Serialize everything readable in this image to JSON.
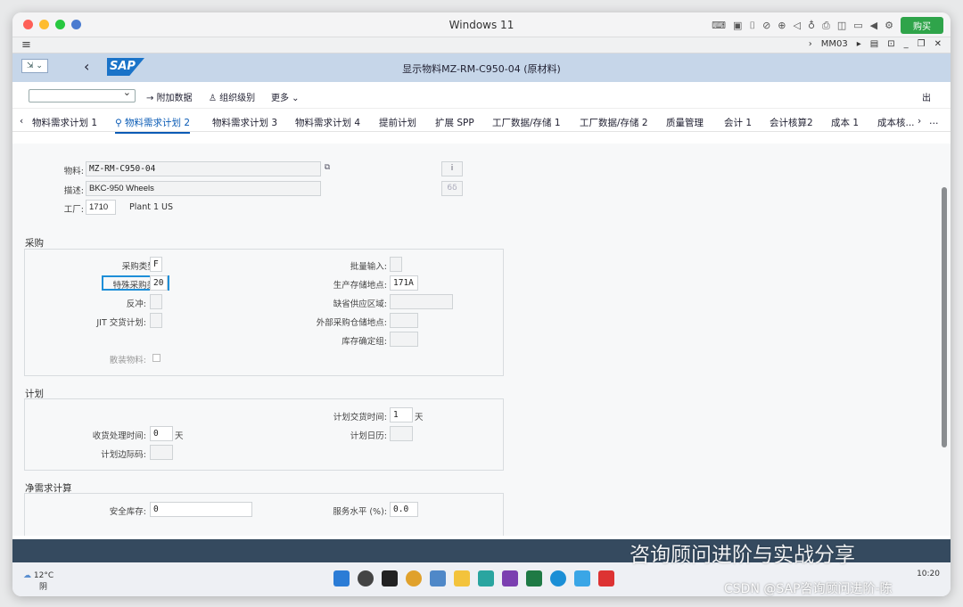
{
  "window": {
    "title": "Windows 11",
    "buy_label": "购买"
  },
  "menubar": {
    "right": [
      "MM03"
    ]
  },
  "shell": {
    "menu_label": "⇲ ⌄",
    "page_title": "显示物料MZ-RM-C950-04 (原材料)"
  },
  "toolbar": {
    "additional_data": "附加数据",
    "org_levels": "组织级别",
    "more": "更多",
    "exit": "出"
  },
  "tabs": [
    "物料需求计划 1",
    "物料需求计划 2",
    "物料需求计划 3",
    "物料需求计划 4",
    "提前计划",
    "扩展 SPP",
    "工厂数据/存储 1",
    "工厂数据/存储 2",
    "质量管理",
    "会计 1",
    "会计核算2",
    "成本 1",
    "成本核..."
  ],
  "active_tab": "物料需求计划 2",
  "header": {
    "material_label": "物料:",
    "material_value": "MZ-RM-C950-04",
    "desc_label": "描述:",
    "desc_value": "BKC-950 Wheels",
    "plant_label": "工厂:",
    "plant_value": "1710",
    "plant_name": "Plant 1 US",
    "info_icon": "i",
    "link_icon": "6δ"
  },
  "purchasing": {
    "title": "采购",
    "proc_type_label": "采购类型:",
    "proc_type_value": "F",
    "special_proc_label": "特殊采购类:",
    "special_proc_value": "20",
    "backflush_label": "反冲:",
    "jit_label": "JIT 交货计划:",
    "bulk_label": "散装物料:",
    "batch_entry_label": "批量输入:",
    "prod_storage_label": "生产存储地点:",
    "prod_storage_value": "171A",
    "default_supply_label": "缺省供应区域:",
    "ext_storage_label": "外部采购仓储地点:",
    "stock_det_label": "库存确定组:"
  },
  "scheduling": {
    "title": "计划",
    "gr_time_label": "收货处理时间:",
    "gr_time_value": "0",
    "gr_time_unit": "天",
    "margin_label": "计划边际码:",
    "plan_deliv_label": "计划交货时间:",
    "plan_deliv_value": "1",
    "plan_deliv_unit": "天",
    "calendar_label": "计划日历:"
  },
  "net_req": {
    "title": "净需求计算",
    "safety_label": "安全库存:",
    "safety_value": "0",
    "service_label": "服务水平 (%):",
    "service_value": "0.0"
  },
  "taskbar": {
    "temp": "12°C",
    "weather": "阴",
    "time": "10:20"
  },
  "watermark": {
    "line1": "咨询顾问进阶与实战分享",
    "line2": "CSDN @SAP咨询顾问进阶-陈"
  }
}
